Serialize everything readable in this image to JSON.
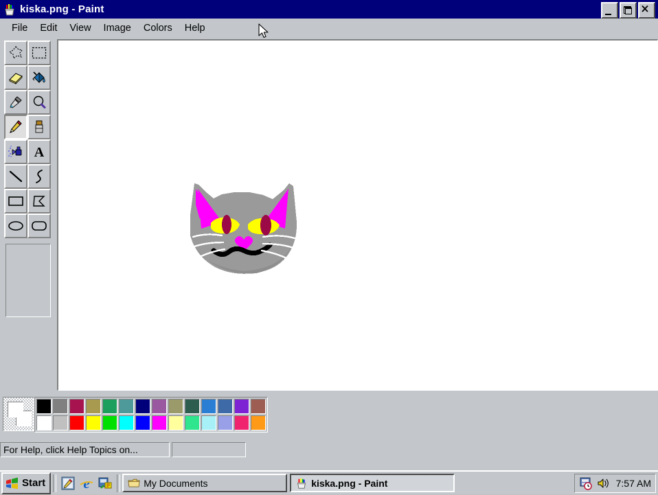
{
  "window": {
    "title": "kiska.png - Paint",
    "icon": "paint-cup-icon",
    "controls": {
      "minimize": "_",
      "restore": "Restore",
      "close": "✕"
    }
  },
  "menubar": {
    "items": [
      {
        "label": "File"
      },
      {
        "label": "Edit"
      },
      {
        "label": "View"
      },
      {
        "label": "Image"
      },
      {
        "label": "Colors"
      },
      {
        "label": "Help"
      }
    ]
  },
  "toolbox": {
    "tools": [
      {
        "name": "free-form-select",
        "label": "Free-Form Select",
        "active": false
      },
      {
        "name": "rectangle-select",
        "label": "Select",
        "active": false
      },
      {
        "name": "eraser",
        "label": "Eraser/Color Eraser",
        "active": false
      },
      {
        "name": "fill-with-color",
        "label": "Fill With Color",
        "active": false
      },
      {
        "name": "pick-color",
        "label": "Pick Color",
        "active": false
      },
      {
        "name": "magnifier",
        "label": "Magnifier",
        "active": false
      },
      {
        "name": "pencil",
        "label": "Pencil",
        "active": true
      },
      {
        "name": "brush",
        "label": "Brush",
        "active": false
      },
      {
        "name": "airbrush",
        "label": "Airbrush",
        "active": false
      },
      {
        "name": "text",
        "label": "Text",
        "active": false
      },
      {
        "name": "line",
        "label": "Line",
        "active": false
      },
      {
        "name": "curve",
        "label": "Curve",
        "active": false
      },
      {
        "name": "rectangle",
        "label": "Rectangle",
        "active": false
      },
      {
        "name": "polygon",
        "label": "Polygon",
        "active": false
      },
      {
        "name": "ellipse",
        "label": "Ellipse",
        "active": false
      },
      {
        "name": "rounded-rectangle",
        "label": "Rounded Rectangle",
        "active": false
      }
    ]
  },
  "palette": {
    "foreground": "#ffffff",
    "background": "#ffffff",
    "row_top": [
      "#000000",
      "#808080",
      "#a7134f",
      "#a89a4e",
      "#1c9e5c",
      "#4e9a9a",
      "#00007b",
      "#9a58a0",
      "#9a9a6b",
      "#2d5d4e",
      "#2a7fd4",
      "#3f6aa8",
      "#7d23d4",
      "#9e5d52"
    ],
    "row_bottom": [
      "#ffffff",
      "#c0c0c0",
      "#ff0000",
      "#ffff00",
      "#00e000",
      "#00ffff",
      "#0000ff",
      "#ff00ff",
      "#ffff9e",
      "#2fe58e",
      "#a8f0f8",
      "#9aa0e8",
      "#f0246e",
      "#ff9a18"
    ]
  },
  "statusbar": {
    "help_text": "For Help, click Help Topics on...",
    "secondary_text": ""
  },
  "canvas": {
    "drawing_name": "cat-face-drawing",
    "colors": {
      "fur": "#9a9a9a",
      "fur_dark": "#8a8a8a",
      "ear_inner": "#ff00ff",
      "eye": "#ffff00",
      "pupil": "#9b0a46",
      "nose": "#ff00ff",
      "mouth": "#000000",
      "whisker": "#ffffff"
    }
  },
  "taskbar": {
    "start_label": "Start",
    "quicklaunch": [
      {
        "name": "show-desktop-icon",
        "label": "Show Desktop"
      },
      {
        "name": "internet-explorer-icon",
        "label": "Internet Explorer"
      },
      {
        "name": "channels-icon",
        "label": "View Channels"
      }
    ],
    "tasks": [
      {
        "name": "task-my-documents",
        "label": "My Documents",
        "icon": "folder-icon",
        "active": false
      },
      {
        "name": "task-paint",
        "label": "kiska.png - Paint",
        "icon": "paint-cup-icon",
        "active": true
      }
    ],
    "tray": {
      "icons": [
        {
          "name": "task-scheduler-icon",
          "label": "Task Scheduler"
        },
        {
          "name": "volume-icon",
          "label": "Volume"
        }
      ],
      "clock": "7:57 AM"
    }
  }
}
